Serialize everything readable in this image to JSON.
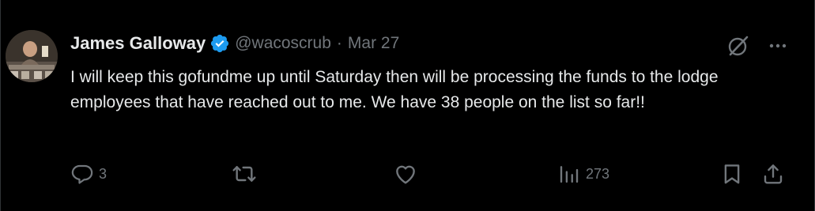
{
  "author": {
    "name": "James Galloway",
    "handle": "@wacoscrub",
    "separator": "·",
    "date": "Mar 27"
  },
  "tweet": {
    "text": "I will keep this gofundme up until Saturday then will be processing the funds to the lodge employees that have reached out to me. We have 38 people on the list so far!!"
  },
  "actions": {
    "reply_count": "3",
    "views_count": "273"
  },
  "icons": {
    "verified": "verified-badge-icon",
    "grok": "grok-icon",
    "more": "more-dots-icon",
    "reply": "reply-icon",
    "retweet": "retweet-icon",
    "like": "heart-icon",
    "views": "views-icon",
    "bookmark": "bookmark-icon",
    "share": "share-icon"
  },
  "colors": {
    "background": "#000000",
    "text_primary": "#e7e9ea",
    "text_secondary": "#71767b",
    "verified_blue": "#1d9bf0"
  }
}
